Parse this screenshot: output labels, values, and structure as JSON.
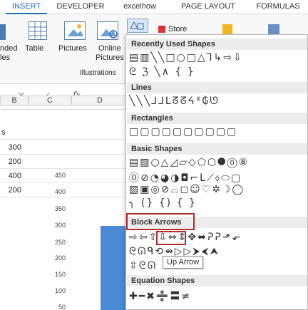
{
  "tabs": [
    "INSERT",
    "DEVELOPER",
    "excelhow",
    "PAGE LAYOUT",
    "FORMULAS"
  ],
  "ribbon": {
    "left_clip": "nded",
    "left_clip2": "les",
    "table": "Table",
    "pictures": "Pictures",
    "online": "Online",
    "online2": "Pictures",
    "illustrations": "Illustrations",
    "store": "Store",
    "fx": "fx"
  },
  "sheet": {
    "col_b": "B",
    "col_c": "C",
    "col_d": "D",
    "row_s": "s",
    "values": [
      "300",
      "200",
      "400",
      "200"
    ],
    "yticks": [
      "450",
      "400",
      "350",
      "300",
      "250",
      "200",
      "150",
      "100",
      "50"
    ]
  },
  "menu": {
    "recent": "Recently Used Shapes",
    "recent_row1": "▤▥╲╲□○□△⅂↳⇨⇩",
    "recent_row2": "ᘓ ℨ ╲∧ {  }",
    "lines": "Lines",
    "lines_row": "╲╲╲⅃⅃ᒪᘔᘔᔦᕽ₲ᘎ",
    "rect": "Rectangles",
    "rect_row": "□▢▢▢▢▢▢▢▢▢",
    "basic": "Basic Shapes",
    "basic_row1": "▤▨○△◿▱◇⬠⬡⯃⓪⑧",
    "basic_row2": "⓪⊘◔◕◑◘⌐ᒪ⟋⬨⬭▢",
    "basic_row3": "▧▣◎⊘⌓◻☺♡✲☽◯",
    "basic_row4": "╮ (} {)  { }",
    "block": "Block Arrows",
    "block_row1": "⇨⇦⇧⇩⇔⇕✥⬌ᕈᕈ⬏⬐",
    "block_row2": "ᘓᘏᑫ⟲⇴▷▷⮞⮜⮝",
    "block_row3": "⇳ᘓᘏ",
    "equation": "Equation Shapes",
    "equation_row": "✚━✖➗〓≠",
    "tooltip": "Up Arrow"
  }
}
